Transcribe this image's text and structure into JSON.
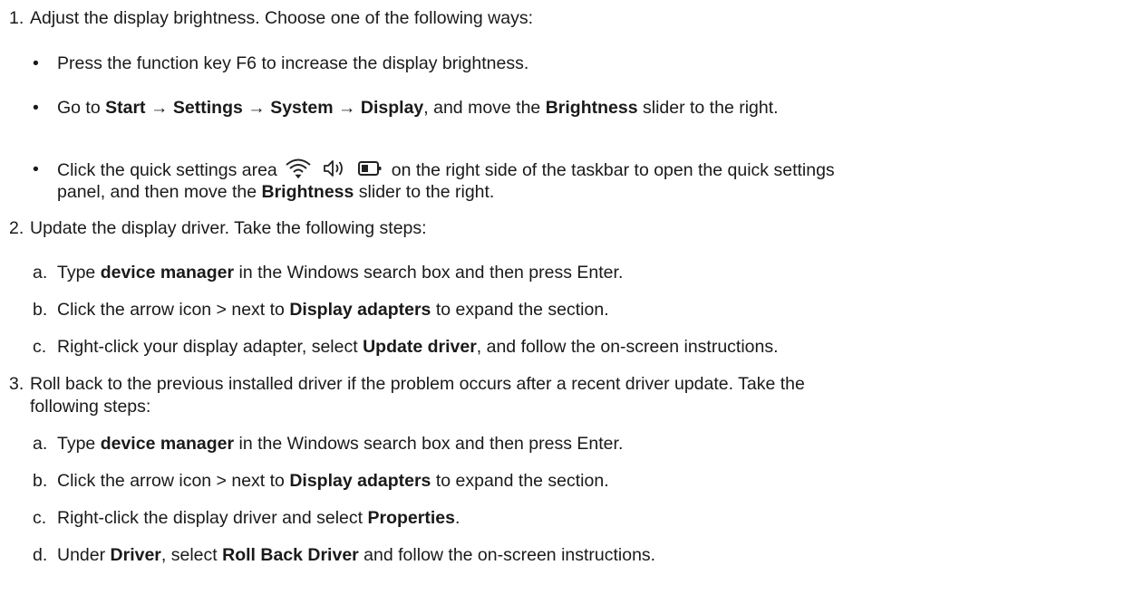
{
  "steps": [
    {
      "number": "1.",
      "text": "Adjust the display brightness. Choose one of the following ways:",
      "bullets": [
        {
          "symbol": "•",
          "text": "Press the function key F6 to increase the display brightness."
        },
        {
          "symbol": "•",
          "pre": "Go to ",
          "path_start": "Start",
          "arrow1": "→",
          "path_settings": "Settings",
          "arrow2": "→",
          "path_system": "System",
          "arrow3": "→",
          "path_display": "Display",
          "mid": ", and move the ",
          "bold": "Brightness",
          "post": " slider to the right."
        },
        {
          "symbol": "•",
          "pre": "Click the quick settings area",
          "icons": [
            "wifi-icon",
            "speaker-icon",
            "battery-icon"
          ],
          "post": "on the right side of the taskbar to open the quick settings",
          "line2_pre": "panel, and then move the ",
          "line2_bold": "Brightness",
          "line2_post": " slider to the right."
        }
      ]
    },
    {
      "number": "2.",
      "text": "Update the display driver. Take the following steps:",
      "substeps": [
        {
          "letter": "a.",
          "pre": "Type ",
          "bold": "device manager",
          "post": " in the Windows search box and then press Enter."
        },
        {
          "letter": "b.",
          "pre": "Click the arrow icon > next to ",
          "bold": "Display adapters",
          "post": " to expand the section."
        },
        {
          "letter": "c.",
          "pre": "Right-click your display adapter, select ",
          "bold": "Update driver",
          "post": ", and follow the on-screen instructions."
        }
      ]
    },
    {
      "number": "3.",
      "text": "Roll back to the previous installed driver if the problem occurs after a recent driver update. Take the",
      "text_line2": "following steps:",
      "substeps": [
        {
          "letter": "a.",
          "pre": "Type ",
          "bold": "device manager",
          "post": " in the Windows search box and then press Enter."
        },
        {
          "letter": "b.",
          "pre": "Click the arrow icon > next to ",
          "bold": "Display adapters",
          "post": " to expand the section."
        },
        {
          "letter": "c.",
          "pre": "Right-click the display driver and select ",
          "bold": "Properties",
          "post": "."
        },
        {
          "letter": "d.",
          "pre": "Under ",
          "bold": "Driver",
          "mid": ", select ",
          "bold2": "Roll Back Driver",
          "post": " and follow the on-screen instructions."
        }
      ]
    }
  ]
}
